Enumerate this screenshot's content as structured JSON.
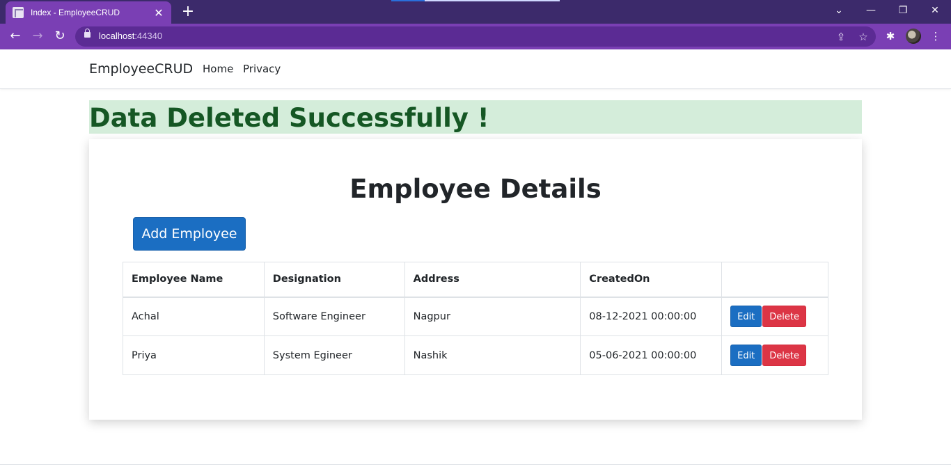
{
  "browser": {
    "tab_title": "Index - EmployeeCRUD",
    "tab_close_glyph": "✕",
    "new_tab_glyph": "+",
    "url_host": "localhost",
    "url_port": ":44340",
    "window_controls": {
      "minimize": "—",
      "restore": "❐",
      "close": "✕",
      "tab_search": "⌄"
    },
    "nav_glyphs": {
      "back": "←",
      "forward": "→",
      "reload": "↻"
    },
    "toolbar_glyphs": {
      "share": "⇪",
      "star": "☆",
      "extensions": "✱",
      "menu": "⋮"
    }
  },
  "site_nav": {
    "brand": "EmployeeCRUD",
    "links": [
      "Home",
      "Privacy"
    ]
  },
  "alert": {
    "message": "Data Deleted Successfully !",
    "bg_color": "#d4edda",
    "text_color": "#155724"
  },
  "card": {
    "title": "Employee Details",
    "add_button_label": "Add Employee"
  },
  "table": {
    "headers": [
      "Employee Name",
      "Designation",
      "Address",
      "CreatedOn",
      ""
    ],
    "rows": [
      {
        "name": "Achal",
        "designation": "Software Engineer",
        "address": "Nagpur",
        "created_on": "08-12-2021 00:00:00"
      },
      {
        "name": "Priya",
        "designation": "System Egineer",
        "address": "Nashik",
        "created_on": "05-06-2021 00:00:00"
      }
    ],
    "edit_label": "Edit",
    "delete_label": "Delete"
  },
  "colors": {
    "browser_frame": "#3c2a6b",
    "browser_toolbar": "#7a3fb4",
    "primary": "#1b6ec2",
    "danger": "#dc3545"
  }
}
